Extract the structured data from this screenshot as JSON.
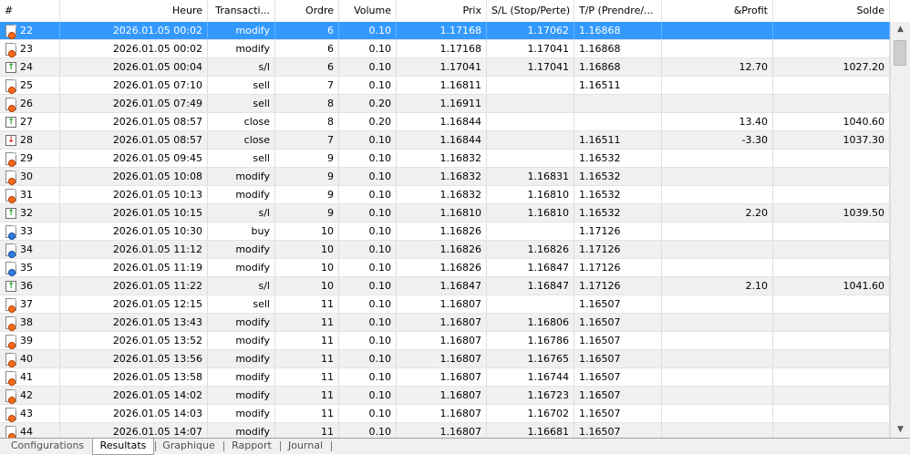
{
  "columns": [
    "#",
    "Heure",
    "Transacti...",
    "Ordre",
    "Volume",
    "Prix",
    "S/L (Stop/Perte)",
    "T/P (Prendre/...",
    "&Profit",
    "Solde"
  ],
  "rows": [
    {
      "id": "22",
      "icon": "orange",
      "time": "2026.01.05 00:02",
      "type": "modify",
      "order": "6",
      "volume": "0.10",
      "price": "1.17168",
      "sl": "1.17062",
      "tp": "1.16868",
      "profit": "",
      "balance": "",
      "selected": true
    },
    {
      "id": "23",
      "icon": "orange",
      "time": "2026.01.05 00:02",
      "type": "modify",
      "order": "6",
      "volume": "0.10",
      "price": "1.17168",
      "sl": "1.17041",
      "tp": "1.16868",
      "profit": "",
      "balance": ""
    },
    {
      "id": "24",
      "icon": "up",
      "time": "2026.01.05 00:04",
      "type": "s/l",
      "order": "6",
      "volume": "0.10",
      "price": "1.17041",
      "sl": "1.17041",
      "tp": "1.16868",
      "profit": "12.70",
      "balance": "1027.20"
    },
    {
      "id": "25",
      "icon": "orange",
      "time": "2026.01.05 07:10",
      "type": "sell",
      "order": "7",
      "volume": "0.10",
      "price": "1.16811",
      "sl": "",
      "tp": "1.16511",
      "profit": "",
      "balance": ""
    },
    {
      "id": "26",
      "icon": "orange",
      "time": "2026.01.05 07:49",
      "type": "sell",
      "order": "8",
      "volume": "0.20",
      "price": "1.16911",
      "sl": "",
      "tp": "",
      "profit": "",
      "balance": ""
    },
    {
      "id": "27",
      "icon": "up",
      "time": "2026.01.05 08:57",
      "type": "close",
      "order": "8",
      "volume": "0.20",
      "price": "1.16844",
      "sl": "",
      "tp": "",
      "profit": "13.40",
      "balance": "1040.60"
    },
    {
      "id": "28",
      "icon": "down",
      "time": "2026.01.05 08:57",
      "type": "close",
      "order": "7",
      "volume": "0.10",
      "price": "1.16844",
      "sl": "",
      "tp": "1.16511",
      "profit": "-3.30",
      "balance": "1037.30"
    },
    {
      "id": "29",
      "icon": "orange",
      "time": "2026.01.05 09:45",
      "type": "sell",
      "order": "9",
      "volume": "0.10",
      "price": "1.16832",
      "sl": "",
      "tp": "1.16532",
      "profit": "",
      "balance": ""
    },
    {
      "id": "30",
      "icon": "orange",
      "time": "2026.01.05 10:08",
      "type": "modify",
      "order": "9",
      "volume": "0.10",
      "price": "1.16832",
      "sl": "1.16831",
      "tp": "1.16532",
      "profit": "",
      "balance": ""
    },
    {
      "id": "31",
      "icon": "orange",
      "time": "2026.01.05 10:13",
      "type": "modify",
      "order": "9",
      "volume": "0.10",
      "price": "1.16832",
      "sl": "1.16810",
      "tp": "1.16532",
      "profit": "",
      "balance": ""
    },
    {
      "id": "32",
      "icon": "up",
      "time": "2026.01.05 10:15",
      "type": "s/l",
      "order": "9",
      "volume": "0.10",
      "price": "1.16810",
      "sl": "1.16810",
      "tp": "1.16532",
      "profit": "2.20",
      "balance": "1039.50"
    },
    {
      "id": "33",
      "icon": "blue",
      "time": "2026.01.05 10:30",
      "type": "buy",
      "order": "10",
      "volume": "0.10",
      "price": "1.16826",
      "sl": "",
      "tp": "1.17126",
      "profit": "",
      "balance": ""
    },
    {
      "id": "34",
      "icon": "blue",
      "time": "2026.01.05 11:12",
      "type": "modify",
      "order": "10",
      "volume": "0.10",
      "price": "1.16826",
      "sl": "1.16826",
      "tp": "1.17126",
      "profit": "",
      "balance": ""
    },
    {
      "id": "35",
      "icon": "blue",
      "time": "2026.01.05 11:19",
      "type": "modify",
      "order": "10",
      "volume": "0.10",
      "price": "1.16826",
      "sl": "1.16847",
      "tp": "1.17126",
      "profit": "",
      "balance": ""
    },
    {
      "id": "36",
      "icon": "up",
      "time": "2026.01.05 11:22",
      "type": "s/l",
      "order": "10",
      "volume": "0.10",
      "price": "1.16847",
      "sl": "1.16847",
      "tp": "1.17126",
      "profit": "2.10",
      "balance": "1041.60"
    },
    {
      "id": "37",
      "icon": "orange",
      "time": "2026.01.05 12:15",
      "type": "sell",
      "order": "11",
      "volume": "0.10",
      "price": "1.16807",
      "sl": "",
      "tp": "1.16507",
      "profit": "",
      "balance": ""
    },
    {
      "id": "38",
      "icon": "orange",
      "time": "2026.01.05 13:43",
      "type": "modify",
      "order": "11",
      "volume": "0.10",
      "price": "1.16807",
      "sl": "1.16806",
      "tp": "1.16507",
      "profit": "",
      "balance": ""
    },
    {
      "id": "39",
      "icon": "orange",
      "time": "2026.01.05 13:52",
      "type": "modify",
      "order": "11",
      "volume": "0.10",
      "price": "1.16807",
      "sl": "1.16786",
      "tp": "1.16507",
      "profit": "",
      "balance": ""
    },
    {
      "id": "40",
      "icon": "orange",
      "time": "2026.01.05 13:56",
      "type": "modify",
      "order": "11",
      "volume": "0.10",
      "price": "1.16807",
      "sl": "1.16765",
      "tp": "1.16507",
      "profit": "",
      "balance": ""
    },
    {
      "id": "41",
      "icon": "orange",
      "time": "2026.01.05 13:58",
      "type": "modify",
      "order": "11",
      "volume": "0.10",
      "price": "1.16807",
      "sl": "1.16744",
      "tp": "1.16507",
      "profit": "",
      "balance": ""
    },
    {
      "id": "42",
      "icon": "orange",
      "time": "2026.01.05 14:02",
      "type": "modify",
      "order": "11",
      "volume": "0.10",
      "price": "1.16807",
      "sl": "1.16723",
      "tp": "1.16507",
      "profit": "",
      "balance": ""
    },
    {
      "id": "43",
      "icon": "orange",
      "time": "2026.01.05 14:03",
      "type": "modify",
      "order": "11",
      "volume": "0.10",
      "price": "1.16807",
      "sl": "1.16702",
      "tp": "1.16507",
      "profit": "",
      "balance": ""
    },
    {
      "id": "44",
      "icon": "orange",
      "time": "2026.01.05 14:07",
      "type": "modify",
      "order": "11",
      "volume": "0.10",
      "price": "1.16807",
      "sl": "1.16681",
      "tp": "1.16507",
      "profit": "",
      "balance": ""
    }
  ],
  "tabs": [
    {
      "label": "Configurations",
      "active": false
    },
    {
      "label": "Resultats",
      "active": true
    },
    {
      "label": "Graphique",
      "active": false
    },
    {
      "label": "Rapport",
      "active": false
    },
    {
      "label": "Journal",
      "active": false
    }
  ],
  "scrollbar": {
    "up_icon": "scroll-up-arrow",
    "down_icon": "scroll-down-arrow",
    "position": 0.0
  },
  "colors": {
    "selected_row": "#3399ff",
    "alt_row": "#f0f0f0",
    "sell_icon": "#ff6a1a",
    "buy_icon": "#2f7de1",
    "profit_arrow": "#1b9a1b",
    "loss_arrow": "#d01818"
  }
}
